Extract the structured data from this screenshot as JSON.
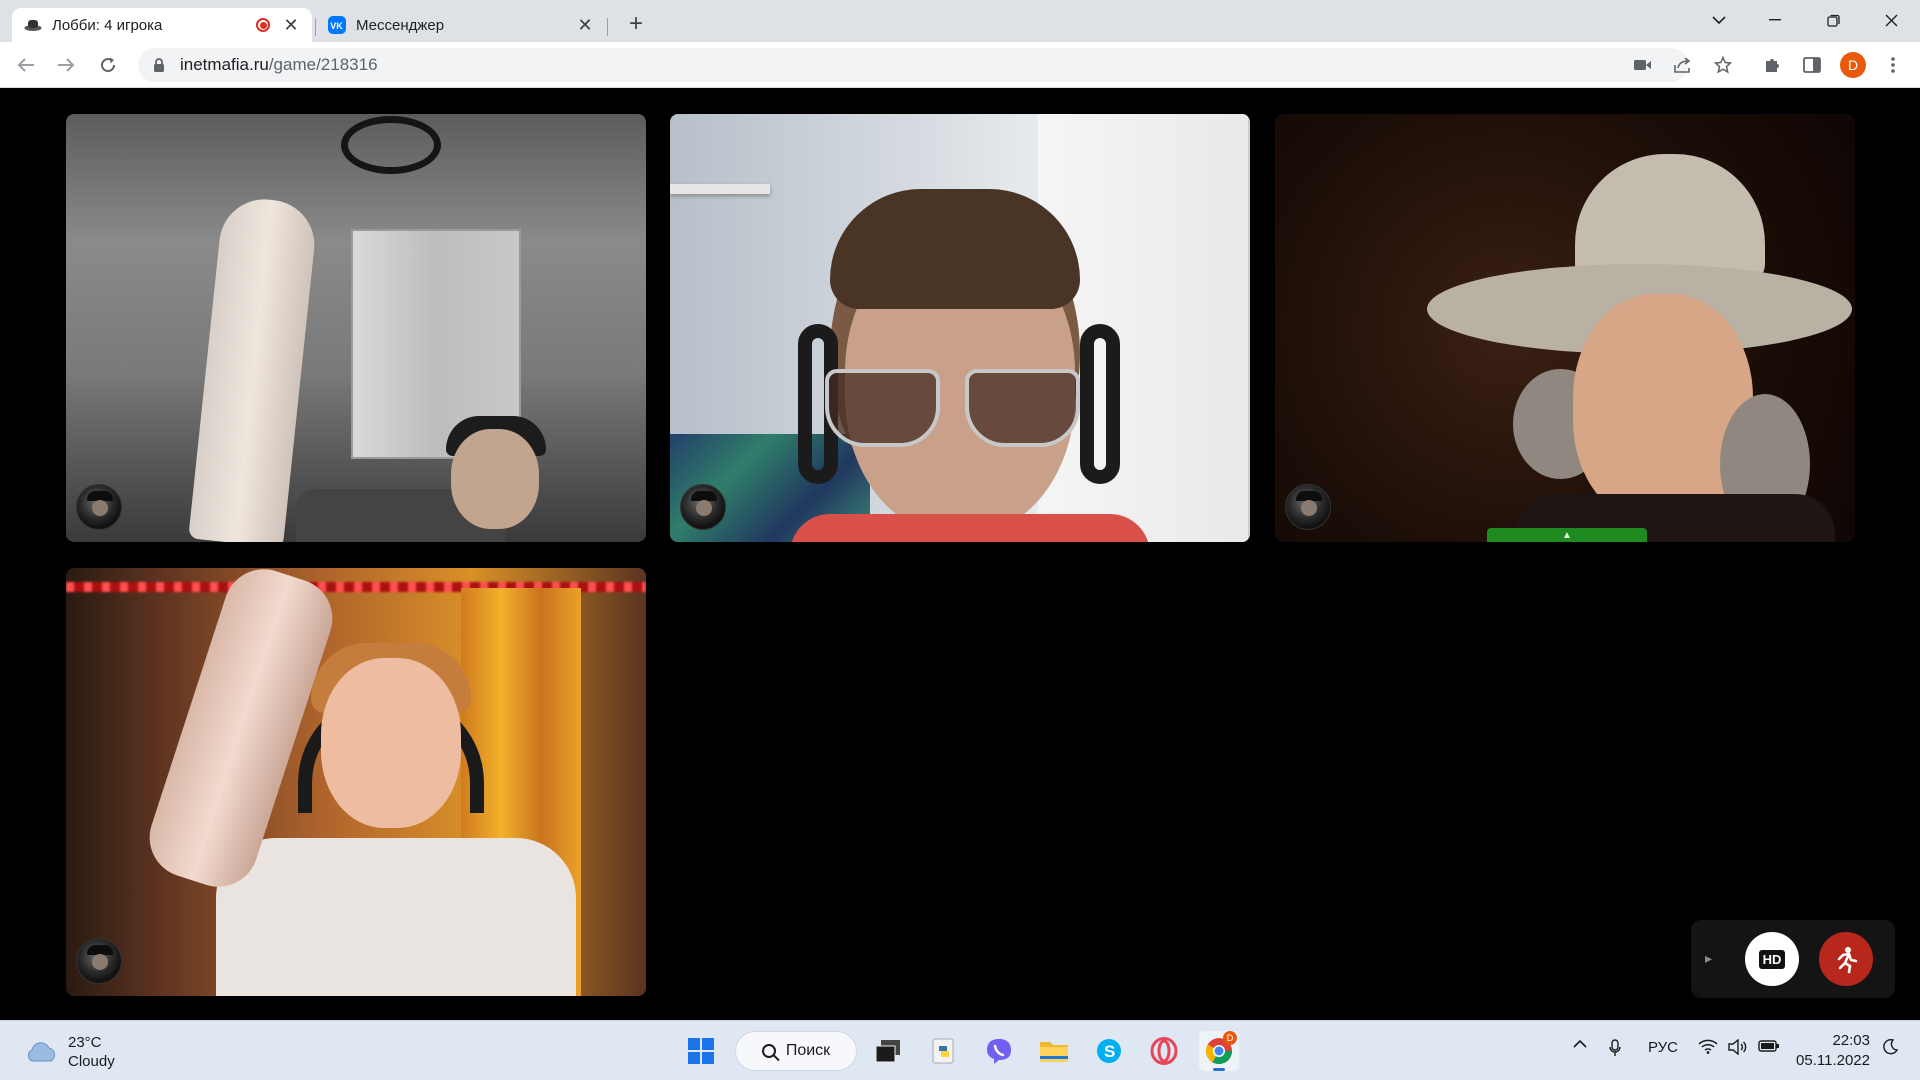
{
  "browser": {
    "tabs": [
      {
        "title": "Лобби: 4 игрока",
        "favicon": "mafia-hat-icon",
        "recording": true,
        "active": true
      },
      {
        "title": "Мессенджер",
        "favicon": "vk-icon",
        "active": false
      }
    ],
    "new_tab_label": "+",
    "url_host": "inetmafia.ru",
    "url_path": "/game/218316",
    "profile_initial": "D",
    "accent_profile": "#e8590c"
  },
  "game": {
    "players": [
      {
        "id": "player-1",
        "avatar": "mafia-avatar-icon"
      },
      {
        "id": "player-2",
        "avatar": "mafia-avatar-icon"
      },
      {
        "id": "player-3",
        "avatar": "mafia-avatar-icon",
        "has_pull_tab": true
      },
      {
        "id": "player-4",
        "avatar": "mafia-avatar-icon"
      }
    ],
    "controls": {
      "hd_label": "HD",
      "exit_color": "#b8271b"
    }
  },
  "taskbar": {
    "weather": {
      "temp": "23°C",
      "condition": "Cloudy"
    },
    "search_label": "Поиск",
    "language": "РУС",
    "time": "22:03",
    "date": "05.11.2022",
    "chrome_badge": "D"
  }
}
